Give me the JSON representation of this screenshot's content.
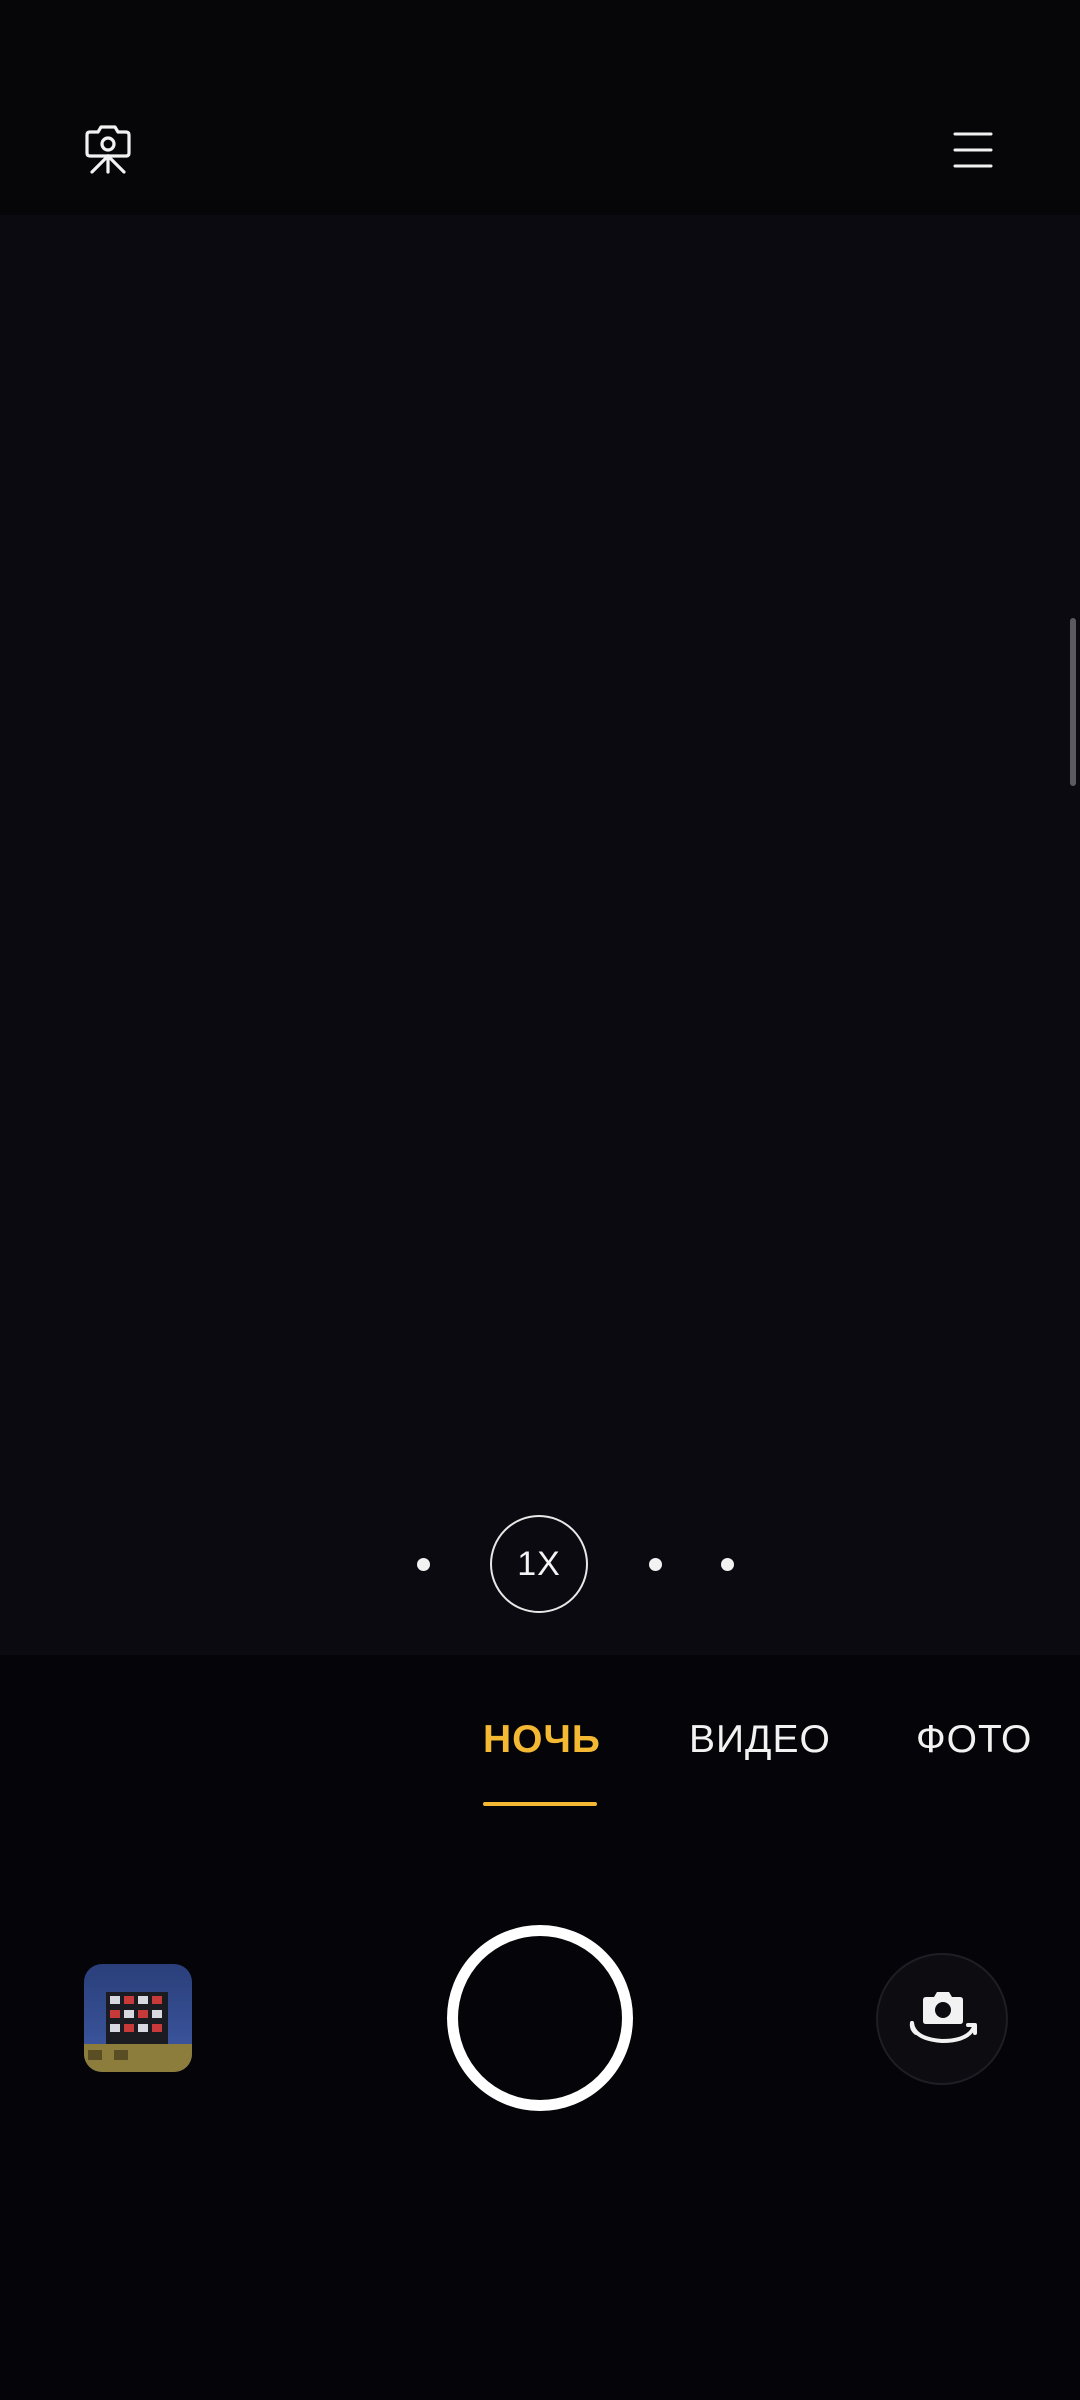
{
  "header": {
    "left_icon": "camera-settings-icon",
    "right_icon": "menu-icon"
  },
  "zoom": {
    "current_label": "1X"
  },
  "modes": {
    "items": [
      {
        "label": "НОЧЬ",
        "active": true
      },
      {
        "label": "ВИДЕО",
        "active": false
      },
      {
        "label": "ФОТО",
        "active": false
      }
    ]
  },
  "controls": {
    "gallery_icon": "gallery-thumbnail",
    "shutter_icon": "shutter-button",
    "switch_icon": "switch-camera-icon"
  },
  "colors": {
    "accent": "#f5b833",
    "background": "#060509",
    "text": "#f2f2f2"
  }
}
